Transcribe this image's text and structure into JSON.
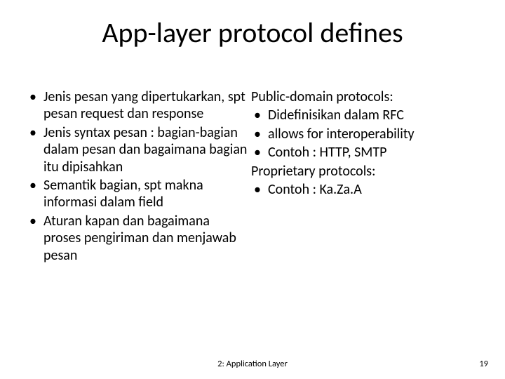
{
  "title": "App-layer protocol defines",
  "left": {
    "items": [
      "Jenis pesan yang dipertukarkan, spt pesan request dan response",
      "Jenis syntax pesan : bagian-bagian dalam pesan dan bagaimana bagian itu dipisahkan",
      "Semantik bagian, spt makna informasi dalam field",
      "Aturan kapan dan bagaimana proses pengiriman dan menjawab pesan"
    ]
  },
  "right": {
    "section1": {
      "heading": "Public-domain protocols:",
      "items": [
        "Didefinisikan dalam RFC",
        "allows for interoperability",
        "Contoh : HTTP, SMTP"
      ]
    },
    "section2": {
      "heading": "Proprietary protocols:",
      "items": [
        "Contoh : Ka.Za.A"
      ]
    }
  },
  "footer": {
    "center": "2: Application Layer",
    "page": "19"
  }
}
